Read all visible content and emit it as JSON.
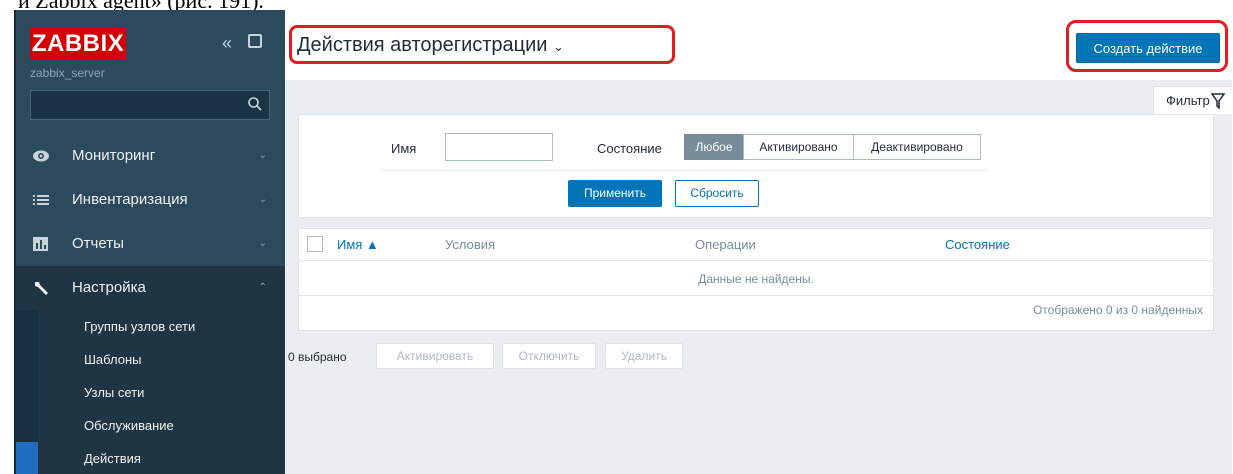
{
  "doc": {
    "top_text": "и Zabbix agent» (рис. 191)."
  },
  "sidebar": {
    "logo": "ZABBIX",
    "server_name": "zabbix_server",
    "search": {
      "value": "",
      "placeholder": ""
    },
    "items": [
      {
        "label": "Мониторинг",
        "icon": "eye-icon",
        "expanded": false
      },
      {
        "label": "Инвентаризация",
        "icon": "list-icon",
        "expanded": false
      },
      {
        "label": "Отчеты",
        "icon": "bar-chart-icon",
        "expanded": false
      },
      {
        "label": "Настройка",
        "icon": "wrench-icon",
        "expanded": true
      }
    ],
    "submenu": [
      {
        "label": "Группы узлов сети"
      },
      {
        "label": "Шаблоны"
      },
      {
        "label": "Узлы сети"
      },
      {
        "label": "Обслуживание"
      },
      {
        "label": "Действия",
        "current": true
      }
    ]
  },
  "header": {
    "title": "Действия авторегистрации",
    "title_chevron": "⌵",
    "create_button": "Создать действие"
  },
  "filter": {
    "tab_label": "Фильтр",
    "name_label": "Имя",
    "name_value": "",
    "state_label": "Состояние",
    "state_options": [
      "Любое",
      "Активировано",
      "Деактивировано"
    ],
    "state_selected": "Любое",
    "apply_label": "Применить",
    "reset_label": "Сбросить"
  },
  "table": {
    "columns": [
      "Имя ▲",
      "Условия",
      "Операции",
      "Состояние"
    ],
    "empty_text": "Данные не найдены.",
    "footer": "Отображено 0 из 0 найденных"
  },
  "mass_actions": {
    "selected": "0 выбрано",
    "buttons": [
      "Активировать",
      "Отключить",
      "Удалить"
    ]
  },
  "colors": {
    "sidebar_bg": "#2b4a5e",
    "logo_red": "#d40000",
    "primary_blue": "#0275b8",
    "highlight_red": "#e31b23"
  }
}
